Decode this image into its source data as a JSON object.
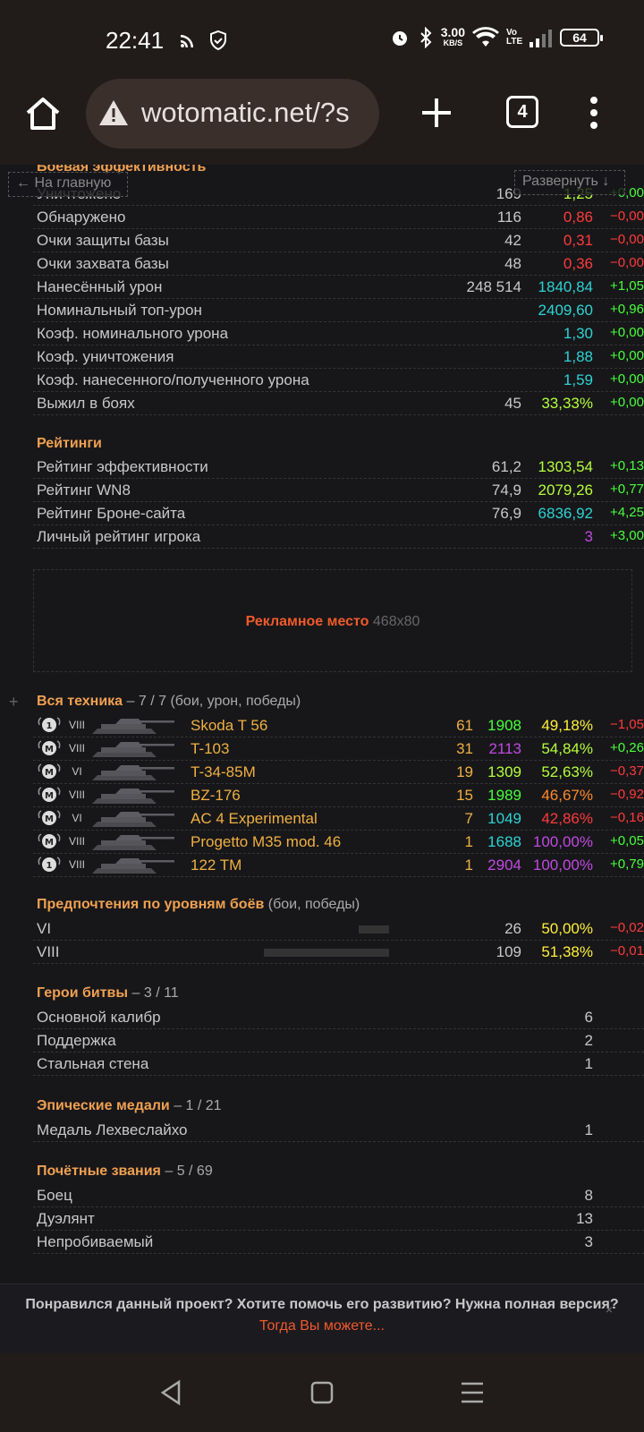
{
  "status": {
    "time": "22:41",
    "net_speed": "3.00",
    "net_unit": "KB/S",
    "battery": "64",
    "volte": "Vo LTE"
  },
  "browser": {
    "url": "wotomatic.net/?s",
    "tab_count": "4"
  },
  "nav": {
    "back": "← На главную",
    "expand": "Развернуть ↓"
  },
  "battle_eff": {
    "title": "Боевая эффективность",
    "rows": [
      {
        "label": "Уничтожено",
        "v1": "169",
        "v2": "1,25",
        "v3": "+0,00"
      },
      {
        "label": "Обнаружено",
        "v1": "116",
        "v2": "0,86",
        "v3": "−0,00"
      },
      {
        "label": "Очки защиты базы",
        "v1": "42",
        "v2": "0,31",
        "v3": "−0,00"
      },
      {
        "label": "Очки захвата базы",
        "v1": "48",
        "v2": "0,36",
        "v3": "−0,00"
      },
      {
        "label": "Нанесённый урон",
        "v1": "248 514",
        "v2": "1840,84",
        "v3": "+1,05"
      },
      {
        "label": "Номинальный топ-урон",
        "v1": "",
        "v2": "2409,60",
        "v3": "+0,96"
      },
      {
        "label": "Коэф. номинального урона",
        "v1": "",
        "v2": "1,30",
        "v3": "+0,00"
      },
      {
        "label": "Коэф. уничтожения",
        "v1": "",
        "v2": "1,88",
        "v3": "+0,00"
      },
      {
        "label": "Коэф. нанесенного/полученного урона",
        "v1": "",
        "v2": "1,59",
        "v3": "+0,00"
      },
      {
        "label": "Выжил в боях",
        "v1": "45",
        "v2": "33,33%",
        "v3": "+0,00"
      }
    ]
  },
  "ratings": {
    "title": "Рейтинги",
    "rows": [
      {
        "label": "Рейтинг эффективности",
        "v1": "61,2",
        "v2": "1303,54",
        "v3": "+0,13"
      },
      {
        "label": "Рейтинг WN8",
        "v1": "74,9",
        "v2": "2079,26",
        "v3": "+0,77"
      },
      {
        "label": "Рейтинг Броне-сайта",
        "v1": "76,9",
        "v2": "6836,92",
        "v3": "+4,25"
      },
      {
        "label": "Личный рейтинг игрока",
        "v1": "",
        "v2": "3",
        "v3": "+3,00"
      }
    ]
  },
  "ad": {
    "text": "Рекламное место",
    "size": "468x80"
  },
  "vehicles": {
    "title": "Вся техника",
    "sub": "– 7 / 7 (бои, урон, победы)",
    "rows": [
      {
        "mark": "1",
        "tier": "VIII",
        "name": "Skoda T 56",
        "battles": "61",
        "dmg": "1908",
        "wr": "49,18%",
        "delta": "−1,05"
      },
      {
        "mark": "M",
        "tier": "VIII",
        "name": "T-103",
        "battles": "31",
        "dmg": "2113",
        "wr": "54,84%",
        "delta": "+0,26"
      },
      {
        "mark": "M",
        "tier": "VI",
        "name": "T-34-85M",
        "battles": "19",
        "dmg": "1309",
        "wr": "52,63%",
        "delta": "−0,37"
      },
      {
        "mark": "M",
        "tier": "VIII",
        "name": "BZ-176",
        "battles": "15",
        "dmg": "1989",
        "wr": "46,67%",
        "delta": "−0,92"
      },
      {
        "mark": "M",
        "tier": "VI",
        "name": "AC 4 Experimental",
        "battles": "7",
        "dmg": "1049",
        "wr": "42,86%",
        "delta": "−0,16"
      },
      {
        "mark": "M",
        "tier": "VIII",
        "name": "Progetto M35 mod. 46",
        "battles": "1",
        "dmg": "1688",
        "wr": "100,00%",
        "delta": "+0,05"
      },
      {
        "mark": "1",
        "tier": "VIII",
        "name": "122 TM",
        "battles": "1",
        "dmg": "2904",
        "wr": "100,00%",
        "delta": "+0,79"
      }
    ]
  },
  "tiers": {
    "title": "Предпочтения по уровням боёв",
    "sub": "(бои, победы)",
    "rows": [
      {
        "label": "VI",
        "battles": "26",
        "wr": "50,00%",
        "delta": "−0,02",
        "share": 0.24
      },
      {
        "label": "VIII",
        "battles": "109",
        "wr": "51,38%",
        "delta": "−0,01",
        "share": 1.0
      }
    ]
  },
  "heroes": {
    "title": "Герои битвы",
    "sub": "– 3 / 11",
    "rows": [
      {
        "label": "Основной калибр",
        "count": "6"
      },
      {
        "label": "Поддержка",
        "count": "2"
      },
      {
        "label": "Стальная стена",
        "count": "1"
      }
    ]
  },
  "epic": {
    "title": "Эпические медали",
    "sub": "– 1 / 21",
    "rows": [
      {
        "label": "Медаль Лехвеслайхо",
        "count": "1"
      }
    ]
  },
  "honor": {
    "title": "Почётные звания",
    "sub": "– 5 / 69",
    "rows": [
      {
        "label": "Боец",
        "count": "8"
      },
      {
        "label": "Дуэлянт",
        "count": "13"
      },
      {
        "label": "Непробиваемый",
        "count": "3"
      }
    ]
  },
  "footer": {
    "question": "Понравился данный проект? Хотите помочь его развитию? Нужна полная версия?",
    "link": "Тогда Вы можете...",
    "close": "×"
  },
  "colors": {
    "accent": "#f0a050",
    "ad": "#f05a2a",
    "bg": "#17171a"
  }
}
